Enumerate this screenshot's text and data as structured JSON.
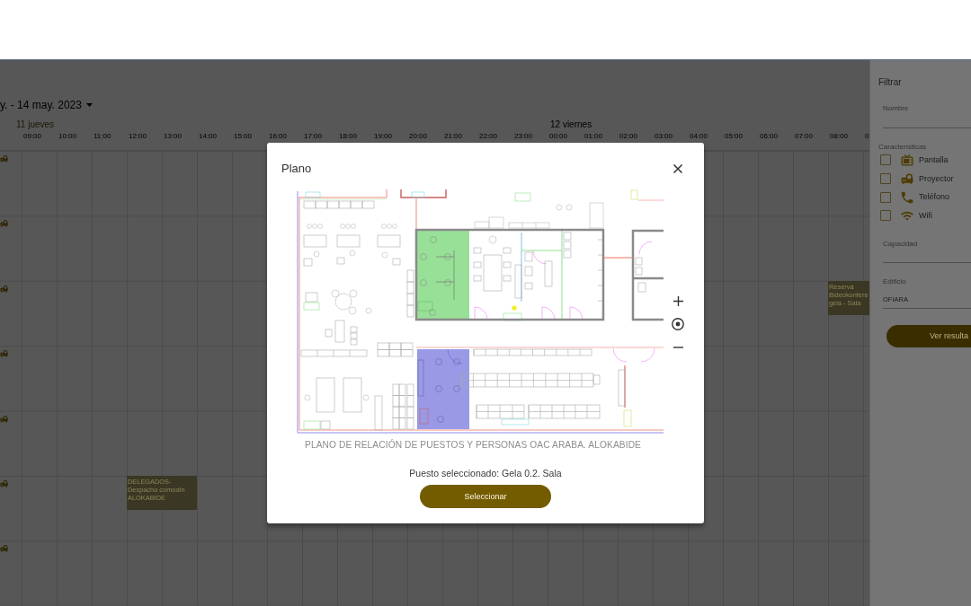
{
  "calendar": {
    "date_range": "y. - 14 may. 2023",
    "days": [
      {
        "label": "11 jueves",
        "today": true,
        "times": [
          "09:00",
          "10:00",
          "11:00",
          "12:00",
          "13:00",
          "14:00",
          "15:00",
          "16:00",
          "17:00",
          "18:00",
          "19:00",
          "20:00",
          "21:00",
          "22:00",
          "23:00"
        ]
      },
      {
        "label": "12 viernes",
        "today": false,
        "times": [
          "00:00",
          "01:00",
          "02:00",
          "03:00",
          "04:00",
          "05:00",
          "06:00",
          "07:00",
          "08:00",
          "0"
        ]
      }
    ],
    "events": [
      {
        "text": "DELEGADOS-\nDespacho comodín\nALOKABIDE"
      },
      {
        "text": "Reserva\nBideokonfere\ngela - Sala"
      }
    ]
  },
  "filter_panel": {
    "title": "Filtrar",
    "name_field": {
      "label": "Nombre"
    },
    "features_label": "Características",
    "features": [
      {
        "label": "Pantalla",
        "checked": false
      },
      {
        "label": "Proyector",
        "checked": false
      },
      {
        "label": "Teléfono",
        "checked": false
      },
      {
        "label": "Wifi",
        "checked": false
      }
    ],
    "capacity_field": {
      "label": "Capacidad"
    },
    "building_field": {
      "label": "Edificio",
      "value": "OFIARA"
    },
    "button": "Ver resulta"
  },
  "dialog": {
    "title": "Plano",
    "floor_plan": {
      "highlighted_rooms": [
        {
          "color": "#98e098"
        },
        {
          "color": "#9999e6"
        }
      ],
      "caption": "PLANO DE RELACIÓN DE PUESTOS Y PERSONAS OAC ARABA. ALOKABIDE"
    },
    "selection": "Puesto seleccionado: Gela 0.2. Sala",
    "button": "Seleccionar"
  }
}
